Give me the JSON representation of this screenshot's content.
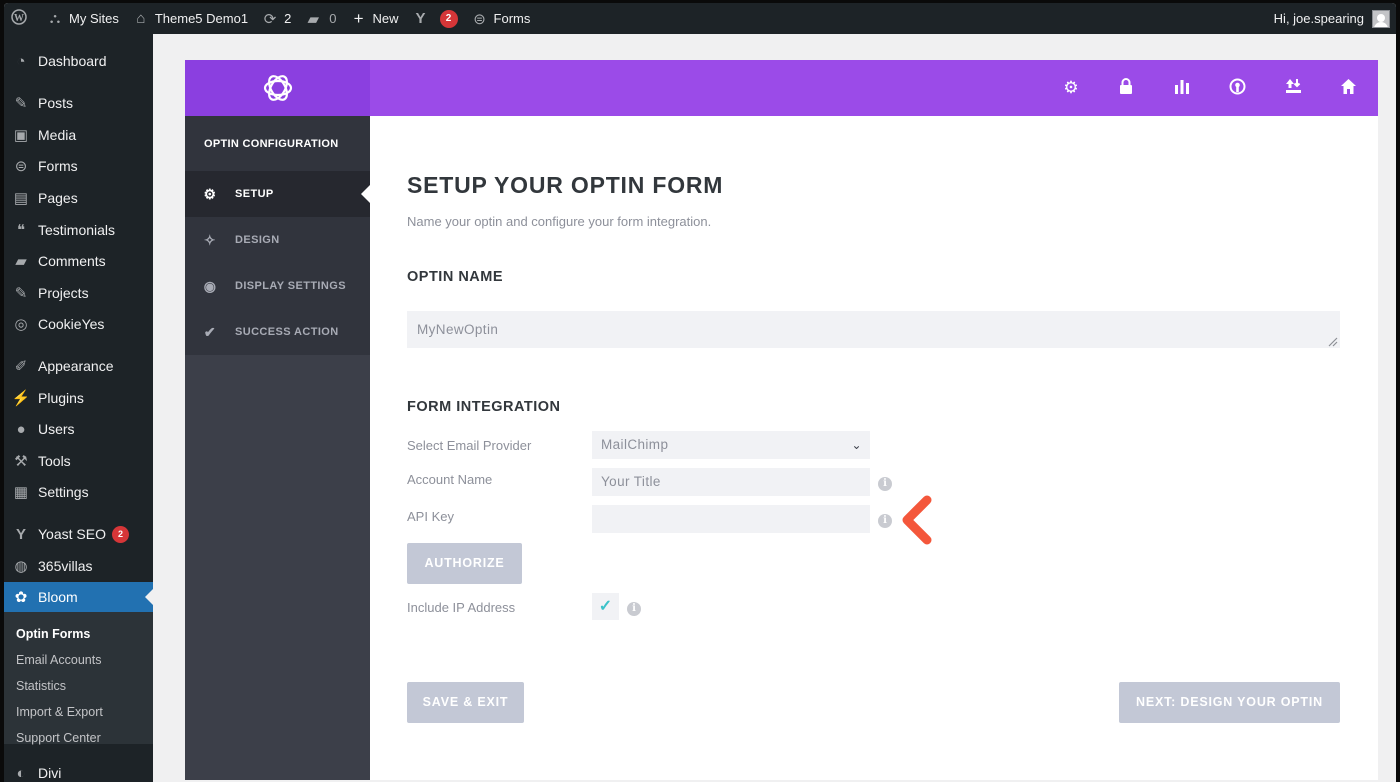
{
  "admin_bar": {
    "my_sites": "My Sites",
    "site_name": "Theme5 Demo1",
    "updates_count": "2",
    "comments_count": "0",
    "new_label": "New",
    "yoast_badge": "2",
    "forms_label": "Forms",
    "greeting": "Hi, joe.spearing"
  },
  "sidebar": {
    "items": [
      {
        "label": "Dashboard",
        "icon": "dashboard-icon"
      },
      {
        "label": "Posts",
        "icon": "pin-icon"
      },
      {
        "label": "Media",
        "icon": "media-icon"
      },
      {
        "label": "Forms",
        "icon": "forms-icon"
      },
      {
        "label": "Pages",
        "icon": "pages-icon"
      },
      {
        "label": "Testimonials",
        "icon": "testimonials-icon"
      },
      {
        "label": "Comments",
        "icon": "comment-icon"
      },
      {
        "label": "Projects",
        "icon": "pin-icon"
      },
      {
        "label": "CookieYes",
        "icon": "cookie-icon"
      },
      {
        "label": "Appearance",
        "icon": "brush-icon"
      },
      {
        "label": "Plugins",
        "icon": "plugin-icon"
      },
      {
        "label": "Users",
        "icon": "user-icon"
      },
      {
        "label": "Tools",
        "icon": "wrench-icon"
      },
      {
        "label": "Settings",
        "icon": "settings-icon"
      },
      {
        "label": "Yoast SEO",
        "icon": "yoast-icon",
        "badge": "2"
      },
      {
        "label": "365villas",
        "icon": "globe-icon"
      },
      {
        "label": "Bloom",
        "icon": "bloom-icon"
      },
      {
        "label": "Divi",
        "icon": "divi-icon"
      }
    ],
    "submenu": [
      "Optin Forms",
      "Email Accounts",
      "Statistics",
      "Import & Export",
      "Support Center"
    ]
  },
  "bloom_nav": {
    "heading": "OPTIN CONFIGURATION",
    "tabs": [
      {
        "label": "SETUP",
        "icon": "gear-icon"
      },
      {
        "label": "DESIGN",
        "icon": "magic-wand-icon"
      },
      {
        "label": "DISPLAY SETTINGS",
        "icon": "eye-icon"
      },
      {
        "label": "SUCCESS ACTION",
        "icon": "checkmark-icon"
      }
    ]
  },
  "header_icons": [
    "gear-icon",
    "lock-icon",
    "stats-icon",
    "accounts-icon",
    "import-export-icon",
    "home-icon"
  ],
  "main": {
    "title": "SETUP YOUR OPTIN FORM",
    "subtitle": "Name your optin and configure your form integration.",
    "optin_name_heading": "OPTIN NAME",
    "optin_name_value": "MyNewOptin",
    "form_integration_heading": "FORM INTEGRATION",
    "email_provider_label": "Select Email Provider",
    "email_provider_value": "MailChimp",
    "account_name_label": "Account Name",
    "account_name_placeholder": "Your Title",
    "api_key_label": "API Key",
    "api_key_value": "",
    "authorize_button": "AUTHORIZE",
    "include_ip_label": "Include IP Address",
    "include_ip_checked": true,
    "save_exit_button": "SAVE & EXIT",
    "next_button": "NEXT: DESIGN YOUR OPTIN"
  },
  "colors": {
    "header_purple": "#9b4be8",
    "logo_purple": "#8b3fe0",
    "callout_orange": "#f4573b",
    "wp_blue": "#2271b1"
  }
}
